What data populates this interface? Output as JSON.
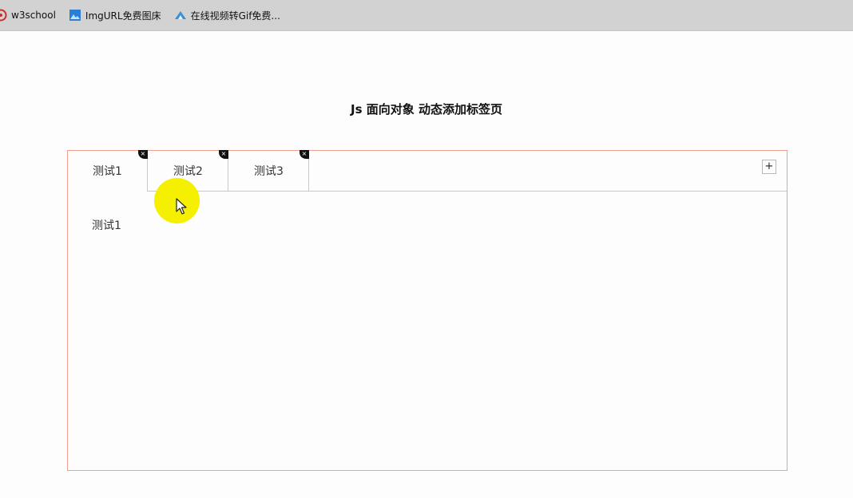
{
  "bookmarks": [
    {
      "label": "w3school",
      "icon": "w3school-icon"
    },
    {
      "label": "ImgURL免费图床",
      "icon": "image-icon"
    },
    {
      "label": "在线视频转Gif免费...",
      "icon": "mountain-icon"
    }
  ],
  "page": {
    "title": "Js 面向对象 动态添加标签页"
  },
  "tabs": [
    {
      "label": "测试1",
      "active": true
    },
    {
      "label": "测试2",
      "active": false
    },
    {
      "label": "测试3",
      "active": false
    }
  ],
  "tab_close_glyph": "×",
  "add_tab_label": "+",
  "content": {
    "text": "测试1"
  },
  "colors": {
    "container_border": "#f0a18e",
    "cursor_highlight": "#f5f000"
  }
}
